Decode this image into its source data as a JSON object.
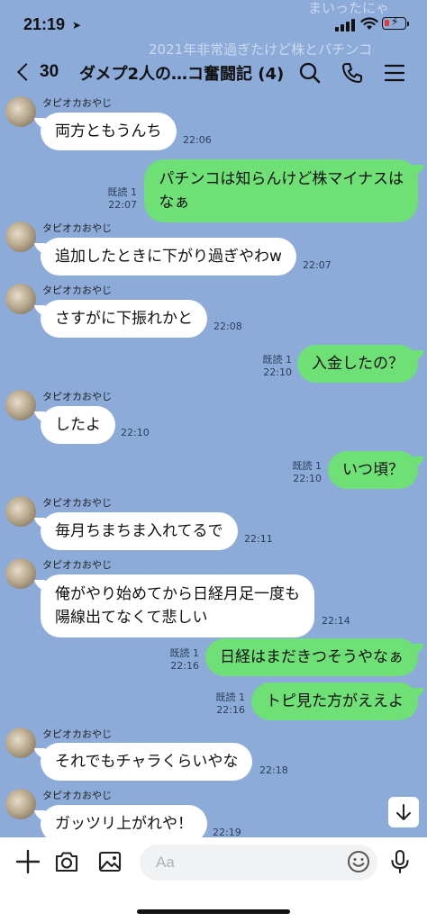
{
  "status_bar": {
    "time": "21:19"
  },
  "background_text": [
    "まいったにゃ",
    "2021年非常過ぎたけど株とパチンコ"
  ],
  "header": {
    "back_count": "30",
    "title": "ダメプ2人の…コ奮闘記 (4)",
    "icons": [
      "search-icon",
      "phone-icon",
      "menu-icon"
    ]
  },
  "messages": [
    {
      "side": "in",
      "sender": "タピオカおやじ",
      "text": "両方ともうんち",
      "time": "22:06"
    },
    {
      "side": "out",
      "read": "既読 1",
      "lines": [
        "パチンコは知らんけど株マイナスは",
        "なぁ"
      ],
      "time": "22:07"
    },
    {
      "side": "in",
      "sender": "タピオカおやじ",
      "text": "追加したときに下がり過ぎやわw",
      "time": "22:07"
    },
    {
      "side": "in",
      "sender": "タピオカおやじ",
      "text": "さすがに下振れかと",
      "time": "22:08"
    },
    {
      "side": "out",
      "read": "既読 1",
      "text": "入金したの？",
      "time": "22:10"
    },
    {
      "side": "in",
      "sender": "タピオカおやじ",
      "text": "したよ",
      "time": "22:10"
    },
    {
      "side": "out",
      "read": "既読 1",
      "text": "いつ頃？",
      "time": "22:10"
    },
    {
      "side": "in",
      "sender": "タピオカおやじ",
      "text": "毎月ちまちま入れてるで",
      "time": "22:11"
    },
    {
      "side": "in",
      "sender": "タピオカおやじ",
      "lines": [
        "俺がやり始めてから日経月足一度も",
        "陽線出てなくて悲しい"
      ],
      "time": "22:14"
    },
    {
      "side": "out",
      "read": "既読 1",
      "text": "日経はまだきつそうやなぁ",
      "time": "22:16"
    },
    {
      "side": "out",
      "read": "既読 1",
      "text": "トピ見た方がええよ",
      "time": "22:16"
    },
    {
      "side": "in",
      "sender": "タピオカおやじ",
      "text": "それでもチャラくらいやな",
      "time": "22:18"
    },
    {
      "side": "in",
      "sender": "タピオカおやじ",
      "text": "ガッツリ上がれや！",
      "time": "22:19"
    }
  ],
  "input": {
    "placeholder": "Aa"
  },
  "toolbar_icons": [
    "plus-icon",
    "camera-icon",
    "image-icon",
    "emoji-icon",
    "mic-icon"
  ]
}
